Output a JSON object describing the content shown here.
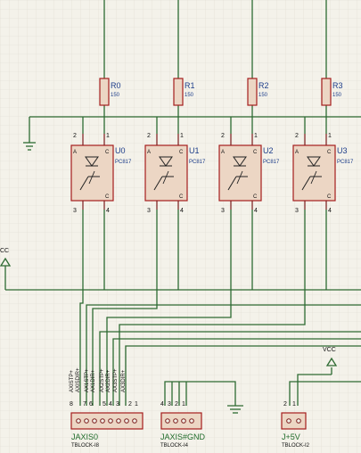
{
  "resistors": [
    {
      "ref": "R0",
      "value": "150"
    },
    {
      "ref": "R1",
      "value": "150"
    },
    {
      "ref": "R2",
      "value": "150"
    },
    {
      "ref": "R3",
      "value": "150"
    }
  ],
  "optocouplers": [
    {
      "ref": "U0",
      "part": "PC817"
    },
    {
      "ref": "U1",
      "part": "PC817"
    },
    {
      "ref": "U2",
      "part": "PC817"
    },
    {
      "ref": "U3",
      "part": "PC817"
    }
  ],
  "opto_pin_numbers": {
    "p1": "1",
    "p2": "2",
    "p3": "3",
    "p4": "4",
    "a": "A",
    "c": "C"
  },
  "left_power": {
    "name": "CC"
  },
  "vcc_symbol": {
    "name": "VCC"
  },
  "header_jaxis0": {
    "ref": "JAXIS0",
    "part": "TBLOCK-I8",
    "signals": [
      "AXISTP+",
      "AXISDIR+",
      "AX1STP+",
      "AX1DIR+",
      "AX2STP+",
      "AX2DIR+",
      "AX3STP+",
      "AX3DIR+"
    ],
    "pin_numbers": [
      "8",
      "7",
      "6",
      "5",
      "4",
      "3",
      "2",
      "1"
    ]
  },
  "header_gnd": {
    "ref": "JAXIS#GND",
    "part": "TBLOCK-I4",
    "pin_numbers": [
      "4",
      "3",
      "2",
      "1"
    ]
  },
  "header_5v": {
    "ref": "J+5V",
    "part": "TBLOCK-I2",
    "pin_numbers": [
      "2",
      "1"
    ]
  }
}
